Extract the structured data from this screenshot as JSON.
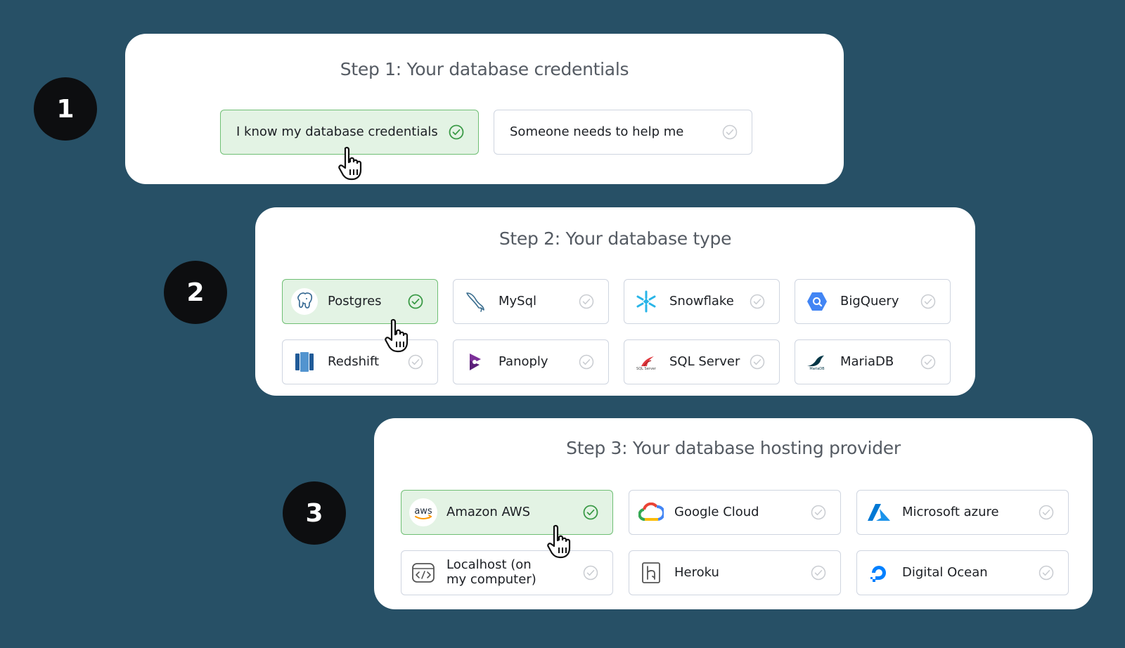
{
  "steps": [
    {
      "number": "1",
      "title": "Step 1: Your database credentials",
      "options": [
        {
          "label": "I know my database credentials",
          "selected": true
        },
        {
          "label": "Someone needs to help me",
          "selected": false
        }
      ]
    },
    {
      "number": "2",
      "title": "Step 2: Your database type",
      "options": [
        {
          "label": "Postgres",
          "icon": "postgres-icon",
          "selected": true
        },
        {
          "label": "MySql",
          "icon": "mysql-dolphin-icon",
          "selected": false
        },
        {
          "label": "Snowflake",
          "icon": "snowflake-icon",
          "selected": false
        },
        {
          "label": "BigQuery",
          "icon": "bigquery-icon",
          "selected": false
        },
        {
          "label": "Redshift",
          "icon": "redshift-icon",
          "selected": false
        },
        {
          "label": "Panoply",
          "icon": "panoply-icon",
          "selected": false
        },
        {
          "label": "SQL Server",
          "icon": "sql-server-icon",
          "selected": false
        },
        {
          "label": "MariaDB",
          "icon": "mariadb-seal-icon",
          "selected": false
        }
      ]
    },
    {
      "number": "3",
      "title": "Step 3: Your database hosting provider",
      "options": [
        {
          "label": "Amazon AWS",
          "icon": "aws-icon",
          "selected": true
        },
        {
          "label": "Google Cloud",
          "icon": "google-cloud-icon",
          "selected": false
        },
        {
          "label": "Microsoft azure",
          "icon": "azure-icon",
          "selected": false
        },
        {
          "label": "Localhost (on my computer)",
          "icon": "localhost-code-window-icon",
          "selected": false
        },
        {
          "label": "Heroku",
          "icon": "heroku-icon",
          "selected": false
        },
        {
          "label": "Digital Ocean",
          "icon": "digital-ocean-icon",
          "selected": false
        }
      ]
    }
  ],
  "logo_text": {
    "aws": "aws",
    "sql_server": "SQL Server",
    "mariadb": "MariaDB"
  },
  "colors": {
    "background": "#275066",
    "selected_fill": "#e3f3e4",
    "selected_border": "#6fbf74",
    "check_green": "#3a9a46",
    "check_gray": "#c9ccd1"
  }
}
